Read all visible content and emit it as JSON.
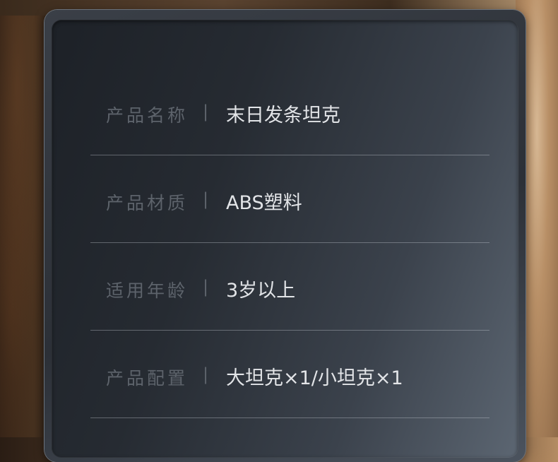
{
  "specs": [
    {
      "label": "产品名称",
      "separator": "|",
      "value": "末日发条坦克"
    },
    {
      "label": "产品材质",
      "separator": "|",
      "value": "ABS塑料"
    },
    {
      "label": "适用年龄",
      "separator": "|",
      "value": "3岁以上"
    },
    {
      "label": "产品配置",
      "separator": "|",
      "value": "大坦克×1/小坦克×1"
    }
  ]
}
